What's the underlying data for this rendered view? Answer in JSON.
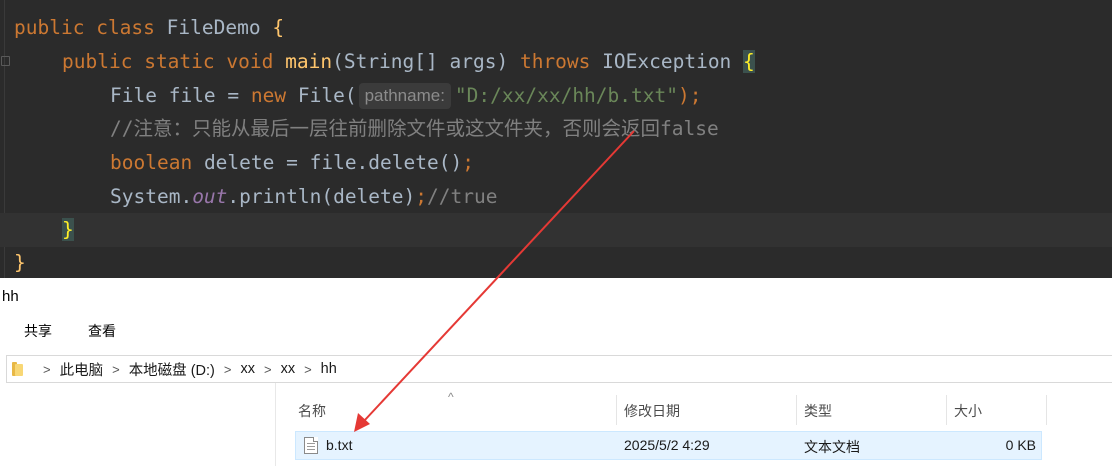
{
  "editor": {
    "line1": {
      "kw1": "public",
      "kw2": "class",
      "name": "FileDemo",
      "brace": "{"
    },
    "line2": {
      "kw1": "public",
      "kw2": "static",
      "kw3": "void",
      "method": "main",
      "params": "(String[] args)",
      "throws": "throws",
      "exc": "IOException",
      "brace": "{"
    },
    "line3": {
      "type": "File file =",
      "new": "new",
      "ctor": "File(",
      "hint": "pathname:",
      "str": "\"D:/xx/xx/hh/b.txt\"",
      "end": ");"
    },
    "line4": {
      "comment": "//注意：只能从最后一层往前删除文件或这文件夹，否则会返回false"
    },
    "line5": {
      "kw": "boolean",
      "rest": "delete = file.delete()",
      "end": ";"
    },
    "line6": {
      "a": "System.",
      "field": "out",
      "b": ".println(delete)",
      "end": ";",
      "comment": "//true"
    },
    "line7": {
      "brace": "}"
    },
    "line8": {
      "brace": "}"
    }
  },
  "explorer": {
    "title": "hh",
    "ribbon": [
      "共享",
      "查看"
    ],
    "breadcrumb": [
      "此电脑",
      "本地磁盘 (D:)",
      "xx",
      "xx",
      "hh"
    ],
    "columns": [
      "名称",
      "修改日期",
      "类型",
      "大小"
    ],
    "files": [
      {
        "name": "b.txt",
        "modified": "2025/5/2 4:29",
        "type": "文本文档",
        "size": "0 KB"
      }
    ]
  },
  "colors": {
    "annotation_arrow": "#e53935",
    "editor_bg": "#2b2b2b",
    "selection": "#e5f3ff"
  }
}
